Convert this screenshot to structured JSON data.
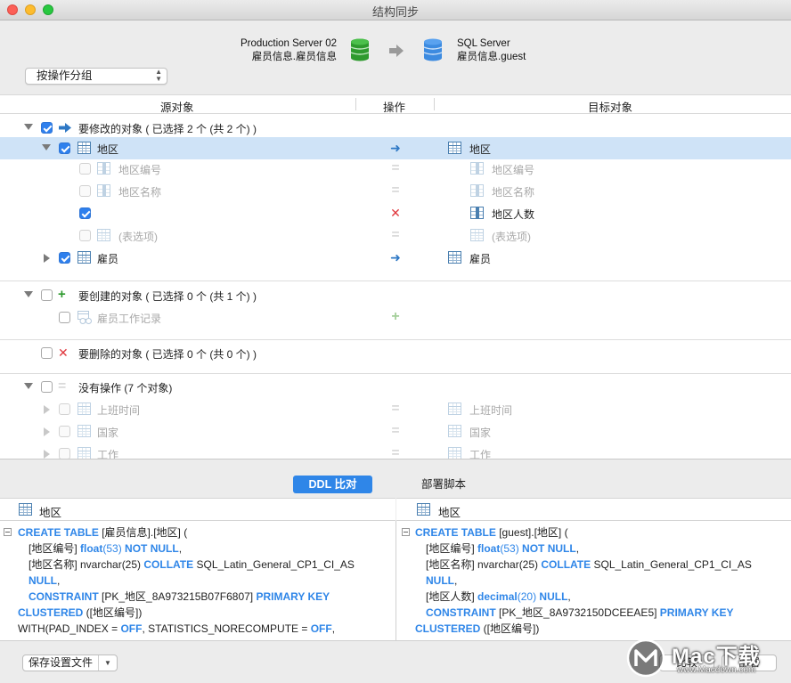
{
  "window": {
    "title": "结构同步"
  },
  "header": {
    "source": {
      "server": "Production Server 02",
      "schema": "雇员信息.雇员信息"
    },
    "target": {
      "server": "SQL Server",
      "schema": "雇员信息.guest"
    },
    "group_select": "按操作分组"
  },
  "columns": {
    "source": "源对象",
    "operation": "操作",
    "target": "目标对象"
  },
  "groups": {
    "modify": {
      "label": "要修改的对象 ( 已选择 2 个 (共 2 个) )"
    },
    "create": {
      "label": "要创建的对象 ( 已选择 0 个 (共 1 个) )"
    },
    "delete": {
      "label": "要删除的对象 ( 已选择 0 个 (共 0 个) )"
    },
    "none": {
      "label": "没有操作 (7 个对象)"
    }
  },
  "rows": {
    "region": {
      "source": "地区",
      "target": "地区"
    },
    "region_no": {
      "source": "地区编号",
      "target": "地区编号"
    },
    "region_name": {
      "source": "地区名称",
      "target": "地区名称"
    },
    "region_count": {
      "source": "",
      "target": "地区人数"
    },
    "table_options": {
      "source": "(表选项)",
      "target": "(表选项)"
    },
    "employee": {
      "source": "雇员",
      "target": "雇员"
    },
    "employee_log": {
      "source": "雇员工作记录"
    },
    "work_time": {
      "source": "上班时间",
      "target": "上班时间"
    },
    "country": {
      "source": "国家",
      "target": "国家"
    },
    "job": {
      "source": "工作",
      "target": "工作"
    }
  },
  "tabs": {
    "ddl": "DDL 比对",
    "script": "部署脚本"
  },
  "ddl": {
    "left_title": "地区",
    "right_title": "地区",
    "left": [
      [
        "CREATE TABLE",
        " [雇员信息].[地区] ("
      ],
      [
        "",
        "[地区编号] ",
        "float",
        "(53) ",
        "NOT NULL",
        ","
      ],
      [
        "",
        "[地区名称] nvarchar(25) ",
        "COLLATE",
        " SQL_Latin_General_CP1_CI_AS"
      ],
      [
        "NULL",
        ","
      ],
      [
        "CONSTRAINT",
        " [PK_地区_8A973215B07F6807] ",
        "PRIMARY KEY"
      ],
      [
        "CLUSTERED",
        " ([地区编号])"
      ],
      [
        "",
        "WITH(PAD_INDEX = ",
        "OFF",
        ", STATISTICS_NORECOMPUTE = ",
        "OFF",
        ","
      ]
    ],
    "right": [
      [
        "CREATE TABLE",
        " [guest].[地区] ("
      ],
      [
        "",
        "[地区编号] ",
        "float",
        "(53) ",
        "NOT NULL",
        ","
      ],
      [
        "",
        "[地区名称] nvarchar(25) ",
        "COLLATE",
        " SQL_Latin_General_CP1_CI_AS"
      ],
      [
        "NULL",
        ","
      ],
      [
        "",
        "[地区人数] ",
        "decimal",
        "(20) ",
        "NULL",
        ","
      ],
      [
        "CONSTRAINT",
        " [PK_地区_8A9732150DCEEAE5] ",
        "PRIMARY KEY"
      ],
      [
        "CLUSTERED",
        " ([地区编号])"
      ]
    ]
  },
  "footer": {
    "save_settings": "保存设置文件",
    "btn_b": "比较",
    "btn_c": "部署"
  },
  "watermark": {
    "brand": "Mac下载",
    "url": "www.Macdown.com"
  },
  "colors": {
    "accent": "#2f86e8",
    "db_source": "#2e9a2e",
    "db_target": "#3d8be0",
    "delete": "#e0383e"
  }
}
